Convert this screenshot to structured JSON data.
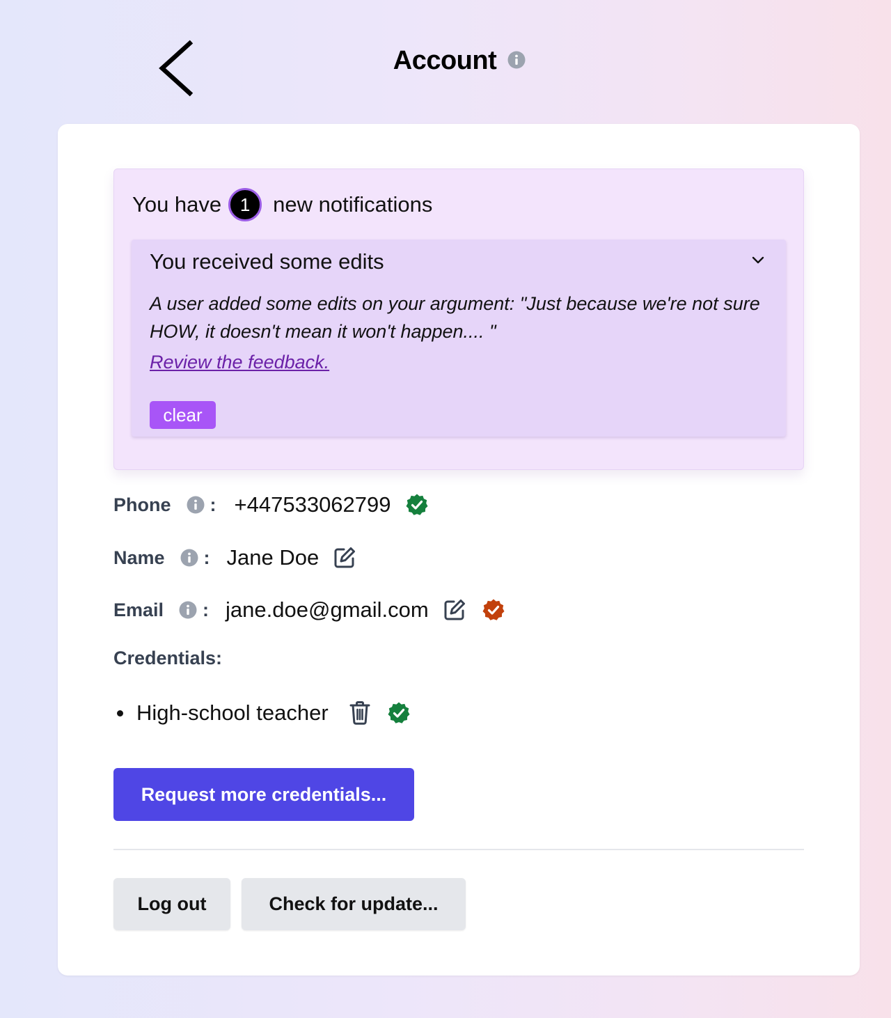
{
  "header": {
    "title": "Account",
    "back_icon": "chevron-left-icon",
    "info_icon": "info-icon"
  },
  "notifications": {
    "prefix": "You have",
    "count": "1",
    "suffix": "new notifications",
    "item": {
      "title": "You received some edits",
      "body": "A user added some edits on your argument: \"Just because we're not sure HOW, it doesn't mean it won't happen.... \"",
      "link": "Review the feedback.",
      "clear_label": "clear",
      "expand_icon": "chevron-down-icon"
    }
  },
  "fields": {
    "phone": {
      "label": "Phone",
      "value": "+447533062799",
      "status": "verified"
    },
    "name": {
      "label": "Name",
      "value": "Jane Doe"
    },
    "email": {
      "label": "Email",
      "value": "jane.doe@gmail.com",
      "status": "pending"
    }
  },
  "credentials": {
    "label": "Credentials:",
    "items": [
      {
        "text": "High-school teacher",
        "status": "verified"
      }
    ]
  },
  "actions": {
    "request_label": "Request more credentials...",
    "logout_label": "Log out",
    "update_label": "Check for update..."
  },
  "colors": {
    "accent": "#4f46e5",
    "notification_bg": "#f3e4fc",
    "notification_item_bg": "#e6d5f9",
    "clear_button": "#a855f7",
    "verified": "#15803d",
    "pending": "#c2410c",
    "link": "#6b21a8"
  },
  "colon": ":"
}
